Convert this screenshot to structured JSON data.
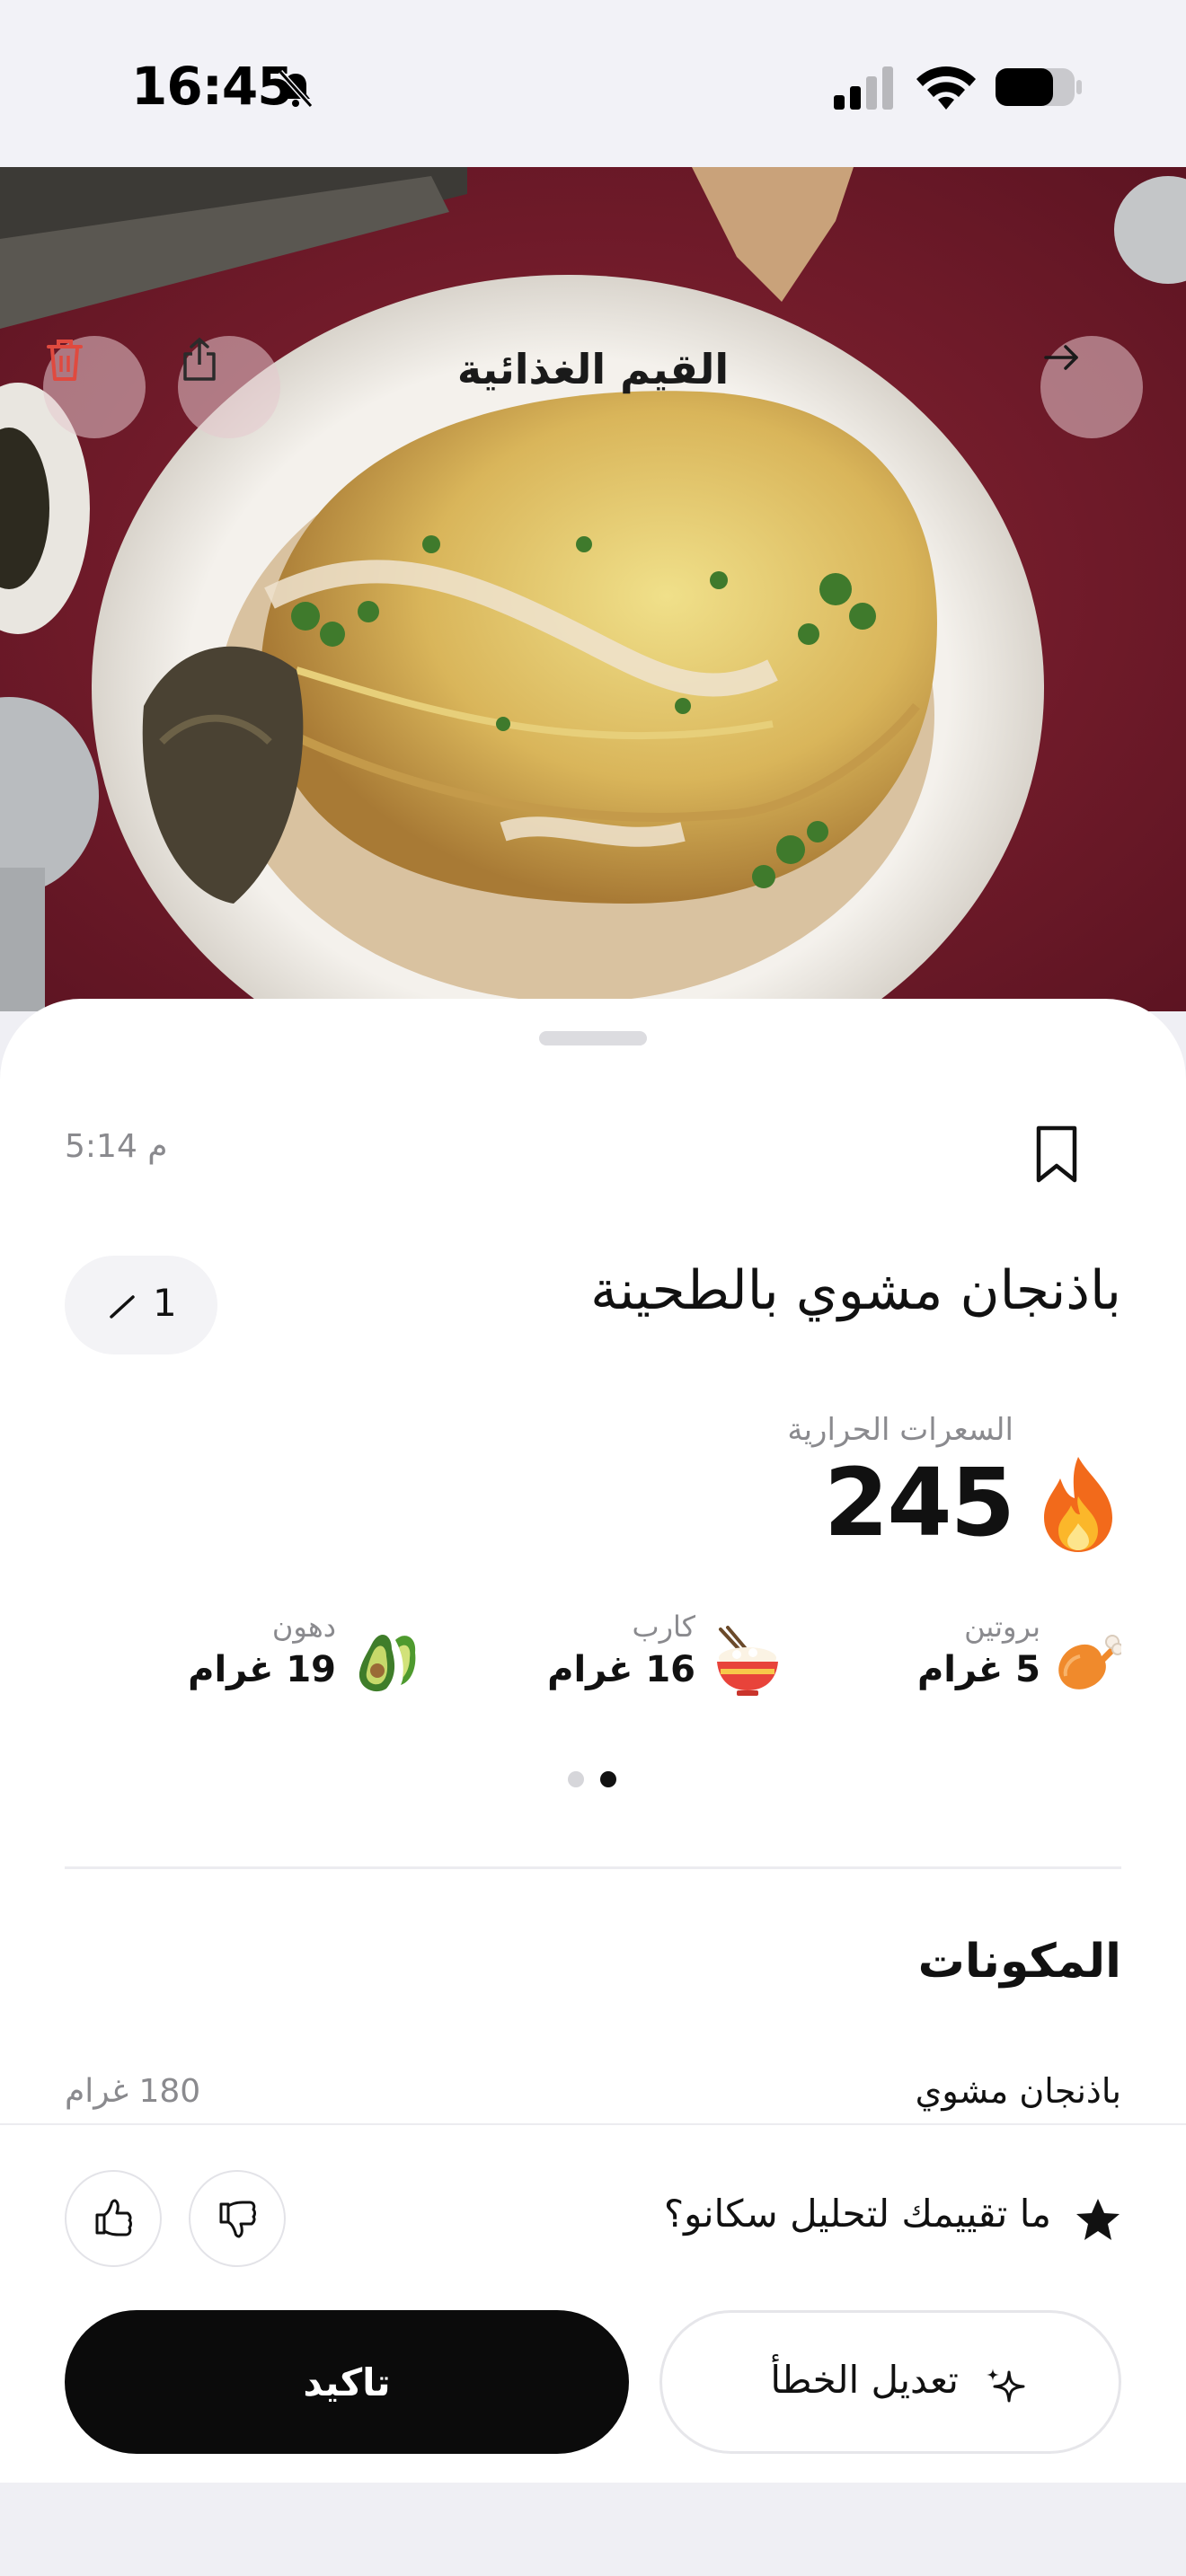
{
  "status_bar": {
    "time": "16:45"
  },
  "header": {
    "title": "القيم الغذائية",
    "icons": [
      "delete-icon",
      "share-icon",
      "arrow-right-icon"
    ]
  },
  "meal": {
    "logged_time": "5:14 م",
    "name": "باذنجان مشوي بالطحينة",
    "quantity": "1"
  },
  "calories": {
    "label": "السعرات الحرارية",
    "value": "245"
  },
  "macros": {
    "protein": {
      "label": "بروتين",
      "value": "5 غرام",
      "icon": "drumstick-icon"
    },
    "carbs": {
      "label": "كارب",
      "value": "16 غرام",
      "icon": "rice-bowl-icon"
    },
    "fat": {
      "label": "دهون",
      "value": "19 غرام",
      "icon": "avocado-icon"
    }
  },
  "pager": {
    "pages": 2,
    "active_index": 1
  },
  "ingredients": {
    "title": "المكونات",
    "items": [
      {
        "name": "باذنجان مشوي",
        "amount": "180 غرام"
      }
    ]
  },
  "rating": {
    "question": "ما تقييمك لتحليل سكانو؟"
  },
  "actions": {
    "confirm_label": "تاكيد",
    "fix_label": "تعديل الخطأ"
  },
  "colors": {
    "primary_button": "#0b0b0b",
    "delete_icon": "#e04a3f",
    "muted_text": "#8a8a8e"
  }
}
